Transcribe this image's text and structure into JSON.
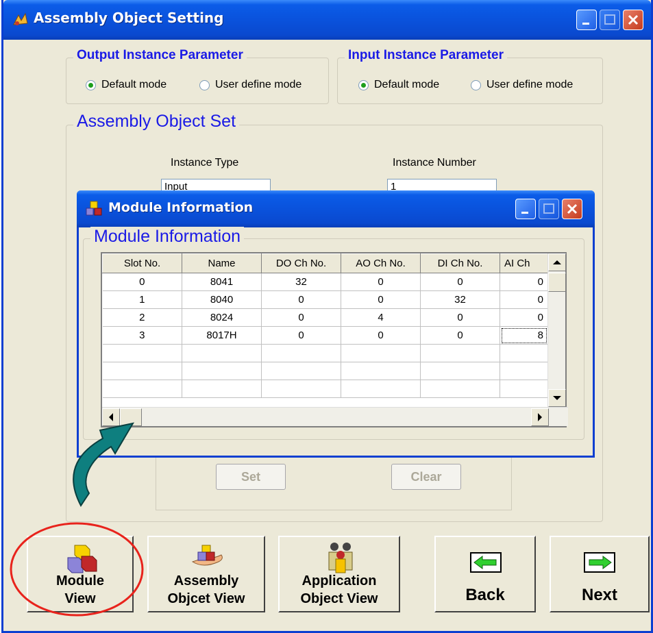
{
  "window": {
    "title": "Assembly Object Setting"
  },
  "output_group": {
    "legend": "Output Instance Parameter",
    "default_label": "Default mode",
    "user_label": "User define mode"
  },
  "input_group": {
    "legend": "Input Instance Parameter",
    "default_label": "Default mode",
    "user_label": "User define mode"
  },
  "assembly_set": {
    "legend": "Assembly Object Set",
    "instance_type_label": "Instance Type",
    "instance_number_label": "Instance Number",
    "instance_type_value": "Input",
    "instance_number_value": "1",
    "set_label": "Set",
    "clear_label": "Clear"
  },
  "module_window": {
    "title": "Module Information",
    "legend": "Module Information",
    "columns": [
      "Slot No.",
      "Name",
      "DO Ch No.",
      "AO Ch No.",
      "DI Ch No.",
      "AI Ch"
    ],
    "rows": [
      [
        "0",
        "8041",
        "32",
        "0",
        "0",
        "0"
      ],
      [
        "1",
        "8040",
        "0",
        "0",
        "32",
        "0"
      ],
      [
        "2",
        "8024",
        "0",
        "4",
        "0",
        "0"
      ],
      [
        "3",
        "8017H",
        "0",
        "0",
        "0",
        "8"
      ]
    ]
  },
  "bottom_buttons": {
    "module_view": [
      "Module",
      "View"
    ],
    "assembly_view": [
      "Assembly",
      "Objcet View"
    ],
    "application_view": [
      "Application",
      "Object View"
    ],
    "back": "Back",
    "next": "Next"
  },
  "colors": {
    "titlebar": "#0a52dc",
    "accent_text": "#1a1ae6",
    "highlight_circle": "#e8231c",
    "arrow": "#0e7f7f"
  }
}
